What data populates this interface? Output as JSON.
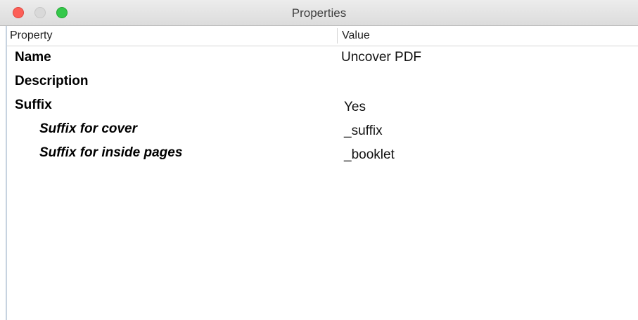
{
  "window": {
    "title": "Properties"
  },
  "table": {
    "headers": {
      "property": "Property",
      "value": "Value"
    },
    "rows": [
      {
        "name": "Name",
        "value": "Uncover PDF"
      },
      {
        "name": "Description",
        "value": ""
      },
      {
        "name": "Suffix",
        "value": "Yes"
      },
      {
        "name": "Suffix for cover",
        "value": "_suffix"
      },
      {
        "name": "Suffix for inside pages",
        "value": "_booklet"
      }
    ]
  }
}
